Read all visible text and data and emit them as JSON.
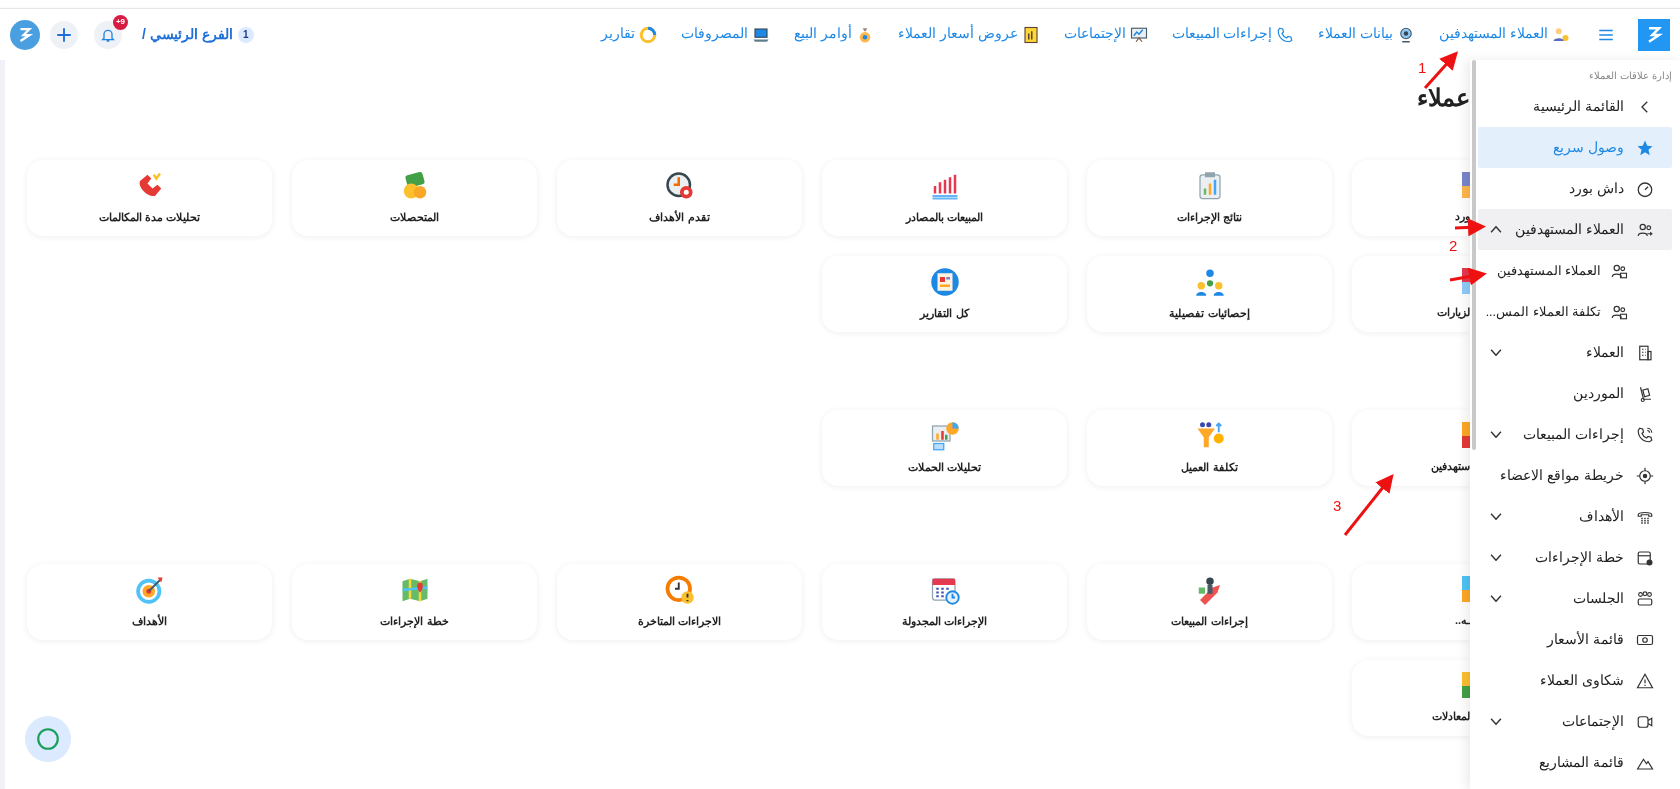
{
  "header": {
    "nav": [
      {
        "label": "العملاء المستهدفين"
      },
      {
        "label": "بيانات العملاء"
      },
      {
        "label": "إجراءات المبيعات"
      },
      {
        "label": "الإجتماعات"
      },
      {
        "label": "عروض أسعار العملاء"
      },
      {
        "label": "أوامر البيع"
      },
      {
        "label": "المصروفات"
      },
      {
        "label": "تقارير"
      }
    ],
    "branch": {
      "count": "1",
      "name": "الفرع الرئيسي /"
    },
    "notifications": {
      "badge": "+9"
    }
  },
  "page": {
    "title": "عملاء",
    "sections": [
      {
        "rows": [
          [
            {
              "label": "ورد"
            },
            {
              "label": "نتائج الإجراءات"
            },
            {
              "label": "المبيعات بالمصادر"
            },
            {
              "label": "تقدم الأهداف"
            },
            {
              "label": "المتحصلات"
            },
            {
              "label": "تحليلات مدة المكالمات"
            }
          ],
          [
            {
              "label": "لزيارات"
            },
            {
              "label": "إحصائيات تفصيلية"
            },
            {
              "label": "كل التقارير"
            }
          ]
        ]
      },
      {
        "rows": [
          [
            {
              "label": "ستهدفين"
            },
            {
              "label": "تكلفة العميل"
            },
            {
              "label": "تحليلات الحملات"
            }
          ]
        ]
      },
      {
        "rows": [
          [
            {
              "label": "ـه.."
            },
            {
              "label": "إجراءات المبيعات"
            },
            {
              "label": "الإجراءات المجدولة"
            },
            {
              "label": "الاجراءات المتاخرة"
            },
            {
              "label": "خطة الإجراءات"
            },
            {
              "label": "الأهداف"
            }
          ],
          [
            {
              "label": "لمعادلات"
            }
          ]
        ]
      }
    ]
  },
  "sidebar": {
    "section_title": "إدارة علاقات العملاء",
    "items": [
      {
        "kind": "back",
        "label": "القائمة الرئيسية",
        "selected": false
      },
      {
        "kind": "link",
        "label": "وصول سريع",
        "selected": true
      },
      {
        "kind": "link",
        "label": "داش بورد",
        "selected": false
      },
      {
        "kind": "group",
        "label": "العملاء المستهدفين",
        "selected": false,
        "expanded": true,
        "children": [
          {
            "kind": "link",
            "label": "العملاء المستهدفين",
            "selected": false
          },
          {
            "kind": "link",
            "label": "تكلفة العملاء المس...",
            "selected": false
          }
        ]
      },
      {
        "kind": "group",
        "label": "العملاء",
        "selected": false,
        "expanded": false
      },
      {
        "kind": "link",
        "label": "الموردين",
        "selected": false
      },
      {
        "kind": "group",
        "label": "إجراءات المبيعات",
        "selected": false,
        "expanded": false
      },
      {
        "kind": "link",
        "label": "خريطة مواقع الاعضاء",
        "selected": false
      },
      {
        "kind": "group",
        "label": "الأهداف",
        "selected": false,
        "expanded": false
      },
      {
        "kind": "group",
        "label": "خطة الإجراءات",
        "selected": false,
        "expanded": false
      },
      {
        "kind": "group",
        "label": "الجلسات",
        "selected": false,
        "expanded": false
      },
      {
        "kind": "link",
        "label": "قائمة الأسعار",
        "selected": false
      },
      {
        "kind": "link",
        "label": "شكاوى العملاء",
        "selected": false
      },
      {
        "kind": "group",
        "label": "الإجتماعات",
        "selected": false,
        "expanded": false
      },
      {
        "kind": "link",
        "label": "قائمة المشاريع",
        "selected": false
      }
    ]
  },
  "annotations": [
    {
      "label": "1"
    },
    {
      "label": "2"
    },
    {
      "label": "3"
    }
  ]
}
